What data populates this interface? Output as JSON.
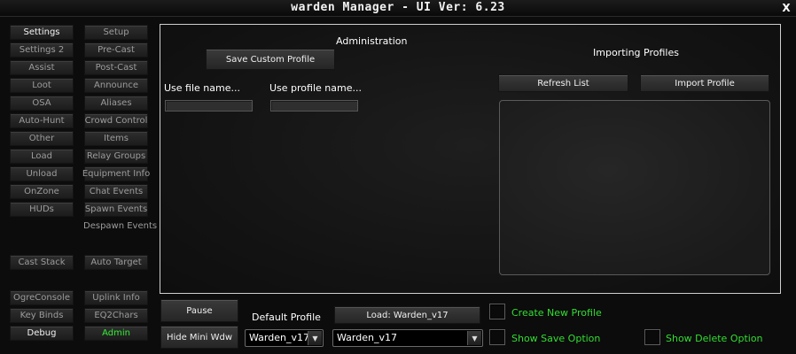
{
  "window": {
    "title": "warden Manager  - UI Ver: 6.23",
    "close_label": "X"
  },
  "nav": {
    "col1": [
      "Settings",
      "Settings 2",
      "Assist",
      "Loot",
      "OSA",
      "Auto-Hunt",
      "Other",
      "Load",
      "Unload",
      "OnZone",
      "HUDs"
    ],
    "col2": [
      "Setup",
      "Pre-Cast",
      "Post-Cast",
      "Announce",
      "Aliases",
      "Crowd Control",
      "Items",
      "Relay Groups",
      "Equipment Info",
      "Chat Events",
      "Spawn Events"
    ],
    "despawn_events": "Despawn Events",
    "cast_stack": "Cast Stack",
    "auto_target": "Auto Target",
    "ogre_console": "OgreConsole",
    "uplink_info": "Uplink Info",
    "key_binds": "Key Binds",
    "eq2chars": "EQ2Chars",
    "debug": "Debug",
    "admin": "Admin"
  },
  "admin": {
    "heading": "Administration",
    "save_custom_profile": "Save Custom Profile",
    "use_file_name_label": "Use file name...",
    "use_profile_name_label": "Use profile name...",
    "file_name_value": "",
    "profile_name_value": ""
  },
  "import": {
    "heading": "Importing Profiles",
    "refresh_list": "Refresh List",
    "import_profile": "Import Profile",
    "items": []
  },
  "bottom": {
    "pause": "Pause",
    "hide_mini_wdw": "Hide Mini Wdw",
    "default_profile_label": "Default Profile",
    "default_profile_value": "Warden_v17",
    "load_button": "Load: Warden_v17",
    "profile_select_value": "Warden_v17",
    "create_new_profile": "Create New Profile",
    "show_save_option": "Show Save Option",
    "show_delete_option": "Show Delete Option"
  },
  "colors": {
    "accent_green": "#33dd33",
    "panel_border": "#cfcfcf"
  }
}
